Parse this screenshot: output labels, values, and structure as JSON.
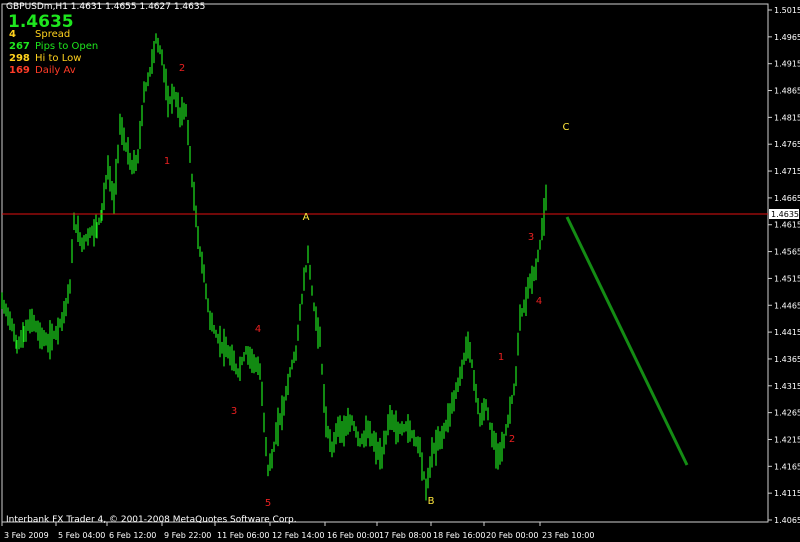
{
  "header": {
    "symbol_line": "GBPUSDm,H1  1.4631 1.4655 1.4627 1.4635",
    "big_price": "1.4635"
  },
  "stats": [
    {
      "value": "4",
      "label": "Spread",
      "color": "#ffd21e"
    },
    {
      "value": "267",
      "label": "Pips to Open",
      "color": "#1ee61e"
    },
    {
      "value": "298",
      "label": "Hi to Low",
      "color": "#ffd21e"
    },
    {
      "value": "169",
      "label": "Daily Av",
      "color": "#ff3c28"
    }
  ],
  "footer": "Interbank FX Trader 4, © 2001-2008 MetaQuotes Software Corp.",
  "chart_data": {
    "type": "line",
    "series": [
      {
        "values": [
          [
            0,
            1.447
          ],
          [
            8,
            1.444
          ],
          [
            15,
            1.439
          ],
          [
            22,
            1.441
          ],
          [
            30,
            1.444
          ],
          [
            38,
            1.441
          ],
          [
            46,
            1.4395
          ],
          [
            54,
            1.4415
          ],
          [
            62,
            1.445
          ],
          [
            68,
            1.45
          ],
          [
            72,
            1.462
          ],
          [
            80,
            1.458
          ],
          [
            88,
            1.46
          ],
          [
            95,
            1.461
          ],
          [
            100,
            1.464
          ],
          [
            106,
            1.472
          ],
          [
            112,
            1.466
          ],
          [
            118,
            1.48
          ],
          [
            124,
            1.476
          ],
          [
            130,
            1.472
          ],
          [
            136,
            1.474
          ],
          [
            142,
            1.486
          ],
          [
            148,
            1.49
          ],
          [
            154,
            1.496
          ],
          [
            160,
            1.493
          ],
          [
            166,
            1.484
          ],
          [
            172,
            1.486
          ],
          [
            178,
            1.482
          ],
          [
            184,
            1.483
          ],
          [
            190,
            1.47
          ],
          [
            196,
            1.459
          ],
          [
            202,
            1.452
          ],
          [
            208,
            1.444
          ],
          [
            214,
            1.441
          ],
          [
            220,
            1.439
          ],
          [
            228,
            1.437
          ],
          [
            236,
            1.434
          ],
          [
            244,
            1.438
          ],
          [
            252,
            1.436
          ],
          [
            258,
            1.434
          ],
          [
            262,
            1.425
          ],
          [
            266,
            1.416
          ],
          [
            270,
            1.418
          ],
          [
            276,
            1.424
          ],
          [
            282,
            1.428
          ],
          [
            288,
            1.434
          ],
          [
            294,
            1.438
          ],
          [
            300,
            1.448
          ],
          [
            306,
            1.456
          ],
          [
            312,
            1.446
          ],
          [
            318,
            1.44
          ],
          [
            324,
            1.424
          ],
          [
            330,
            1.42
          ],
          [
            336,
            1.424
          ],
          [
            342,
            1.423
          ],
          [
            350,
            1.425
          ],
          [
            358,
            1.421
          ],
          [
            366,
            1.423
          ],
          [
            374,
            1.42
          ],
          [
            380,
            1.418
          ],
          [
            388,
            1.426
          ],
          [
            396,
            1.423
          ],
          [
            404,
            1.424
          ],
          [
            412,
            1.422
          ],
          [
            418,
            1.42
          ],
          [
            424,
            1.412
          ],
          [
            430,
            1.419
          ],
          [
            436,
            1.421
          ],
          [
            442,
            1.423
          ],
          [
            450,
            1.428
          ],
          [
            458,
            1.433
          ],
          [
            466,
            1.44
          ],
          [
            472,
            1.433
          ],
          [
            478,
            1.425
          ],
          [
            484,
            1.428
          ],
          [
            490,
            1.422
          ],
          [
            496,
            1.419
          ],
          [
            502,
            1.421
          ],
          [
            508,
            1.427
          ],
          [
            514,
            1.433
          ],
          [
            518,
            1.444
          ],
          [
            522,
            1.446
          ],
          [
            528,
            1.451
          ],
          [
            534,
            1.453
          ],
          [
            538,
            1.458
          ],
          [
            542,
            1.463
          ],
          [
            544,
            1.466
          ]
        ]
      }
    ],
    "y_ticks": [
      "1.5015",
      "1.4965",
      "1.4915",
      "1.4865",
      "1.4815",
      "1.4765",
      "1.4715",
      "1.4665",
      "1.4615",
      "1.4565",
      "1.4515",
      "1.4465",
      "1.4415",
      "1.4365",
      "1.4315",
      "1.4265",
      "1.4215",
      "1.4165",
      "1.4115",
      "1.4065"
    ],
    "ylim": [
      1.4065,
      1.5015
    ],
    "x_ticks": [
      "3 Feb 2009",
      "5 Feb 04:00",
      "6 Feb 12:00",
      "9 Feb 22:00",
      "11 Feb 06:00",
      "12 Feb 14:00",
      "16 Feb 00:00",
      "17 Feb 08:00",
      "18 Feb 16:00",
      "20 Feb 00:00",
      "23 Feb 10:00"
    ],
    "current_price": "1.4635",
    "current_price_value": 1.4635,
    "series_color": "#1ee61e",
    "price_line_color": "#e01010",
    "projection_color": "#148c14",
    "wave_labels": [
      {
        "text": "2",
        "color": "red"
      },
      {
        "text": "1",
        "color": "red"
      },
      {
        "text": "4",
        "color": "red"
      },
      {
        "text": "3",
        "color": "red"
      },
      {
        "text": "5",
        "color": "red"
      },
      {
        "text": "A",
        "color": "yellow"
      },
      {
        "text": "B",
        "color": "yellow"
      },
      {
        "text": "C",
        "color": "yellow"
      },
      {
        "text": "1",
        "color": "red"
      },
      {
        "text": "2",
        "color": "red"
      },
      {
        "text": "3",
        "color": "red"
      },
      {
        "text": "4",
        "color": "red"
      }
    ]
  }
}
